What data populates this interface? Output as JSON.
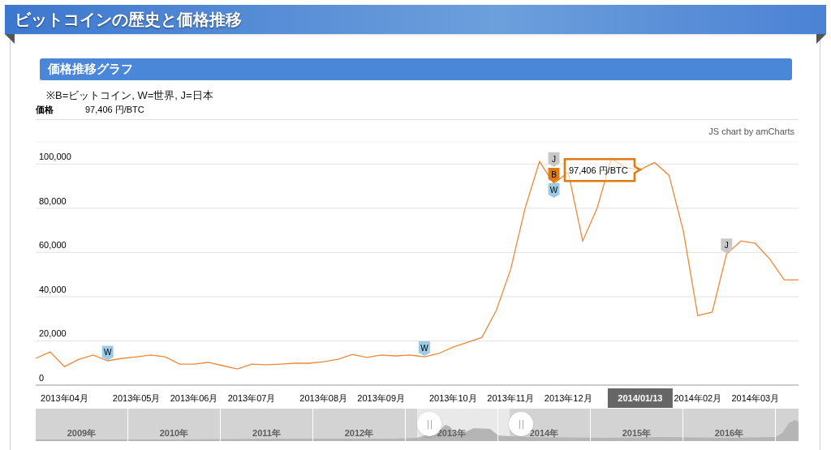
{
  "header": {
    "title": "ビットコインの歴史と価格推移"
  },
  "section": {
    "title": "価格推移グラフ",
    "note": "※B=ビットコイン, W=世界, J=日本",
    "price_label": "価格",
    "price_value": "97,406 円/BTC"
  },
  "chart": {
    "credit": "JS chart by amCharts",
    "chart_data": {
      "type": "line",
      "categories": [
        null,
        null,
        "2013年04月",
        null,
        null,
        null,
        null,
        "2013年05月",
        null,
        null,
        null,
        "2013年06月",
        null,
        null,
        null,
        "2013年07月",
        null,
        null,
        null,
        null,
        "2013年08月",
        null,
        null,
        null,
        "2013年09月",
        null,
        null,
        null,
        null,
        "2013年10月",
        null,
        null,
        null,
        "2013年11月",
        null,
        null,
        null,
        "2013年12月",
        null,
        null,
        null,
        null,
        null,
        null,
        null,
        null,
        "2014年02月",
        null,
        null,
        null,
        "2014年03月",
        null,
        null,
        null
      ],
      "grid": true,
      "series": [
        {
          "color": "#f0883a",
          "values": [
            12100,
            15000,
            8400,
            11700,
            13600,
            11000,
            12100,
            12800,
            13600,
            12800,
            9500,
            9500,
            10300,
            8800,
            7300,
            9500,
            9200,
            9500,
            9900,
            9900,
            10600,
            11700,
            13900,
            12500,
            13600,
            13200,
            13600,
            12800,
            14300,
            17200,
            19400,
            21600,
            33700,
            52400,
            79900,
            101100,
            91200,
            96300,
            65200,
            79900,
            102600,
            98200,
            97400,
            100700,
            94900,
            69600,
            31500,
            33000,
            59300,
            65200,
            64100,
            57100,
            47600,
            47600
          ]
        },
        {
          "name": "J",
          "type": "scatter",
          "color": "#c8c8c8",
          "values": [
            null,
            null,
            null,
            null,
            null,
            null,
            null,
            null,
            null,
            null,
            null,
            null,
            null,
            null,
            null,
            null,
            null,
            null,
            null,
            null,
            null,
            null,
            null,
            null,
            null,
            null,
            null,
            null,
            null,
            null,
            null,
            null,
            null,
            null,
            null,
            null,
            102000,
            null,
            null,
            null,
            null,
            null,
            null,
            null,
            null,
            null,
            null,
            null,
            63000,
            null,
            null,
            null,
            null,
            null
          ]
        },
        {
          "name": "B",
          "type": "scatter",
          "color": "#e07b12",
          "values": [
            null,
            null,
            null,
            null,
            null,
            null,
            null,
            null,
            null,
            null,
            null,
            null,
            null,
            null,
            null,
            null,
            null,
            null,
            null,
            null,
            null,
            null,
            null,
            null,
            null,
            null,
            null,
            null,
            null,
            null,
            null,
            null,
            null,
            null,
            null,
            null,
            95000,
            null,
            null,
            null,
            null,
            null,
            null,
            null,
            null,
            null,
            null,
            null,
            null,
            null,
            null,
            null,
            null,
            null
          ]
        },
        {
          "name": "W",
          "type": "scatter",
          "color": "#9ccbe6",
          "values": [
            null,
            null,
            null,
            null,
            null,
            14500,
            null,
            null,
            null,
            null,
            null,
            null,
            null,
            null,
            null,
            null,
            null,
            null,
            null,
            null,
            null,
            null,
            null,
            null,
            null,
            null,
            null,
            16500,
            null,
            null,
            null,
            null,
            null,
            null,
            null,
            null,
            88000,
            null,
            null,
            null,
            null,
            null,
            null,
            null,
            null,
            null,
            null,
            null,
            null,
            null,
            null,
            null,
            null,
            null
          ]
        }
      ],
      "ylim": [
        0,
        110000
      ],
      "yticks": [
        {
          "value": 0,
          "label": "0"
        },
        {
          "value": 20000,
          "label": "20,000"
        },
        {
          "value": 40000,
          "label": "40,000"
        },
        {
          "value": 60000,
          "label": "60,000"
        },
        {
          "value": 80000,
          "label": "80,000"
        },
        {
          "value": 100000,
          "label": "100,000"
        }
      ]
    },
    "tooltip": "97,406 円/BTC",
    "cursor_label": "2014/01/13"
  },
  "navigator": {
    "years": [
      "2009年",
      "2010年",
      "2011年",
      "2012年",
      "2013年",
      "2014年",
      "2015年",
      "2016年"
    ]
  }
}
